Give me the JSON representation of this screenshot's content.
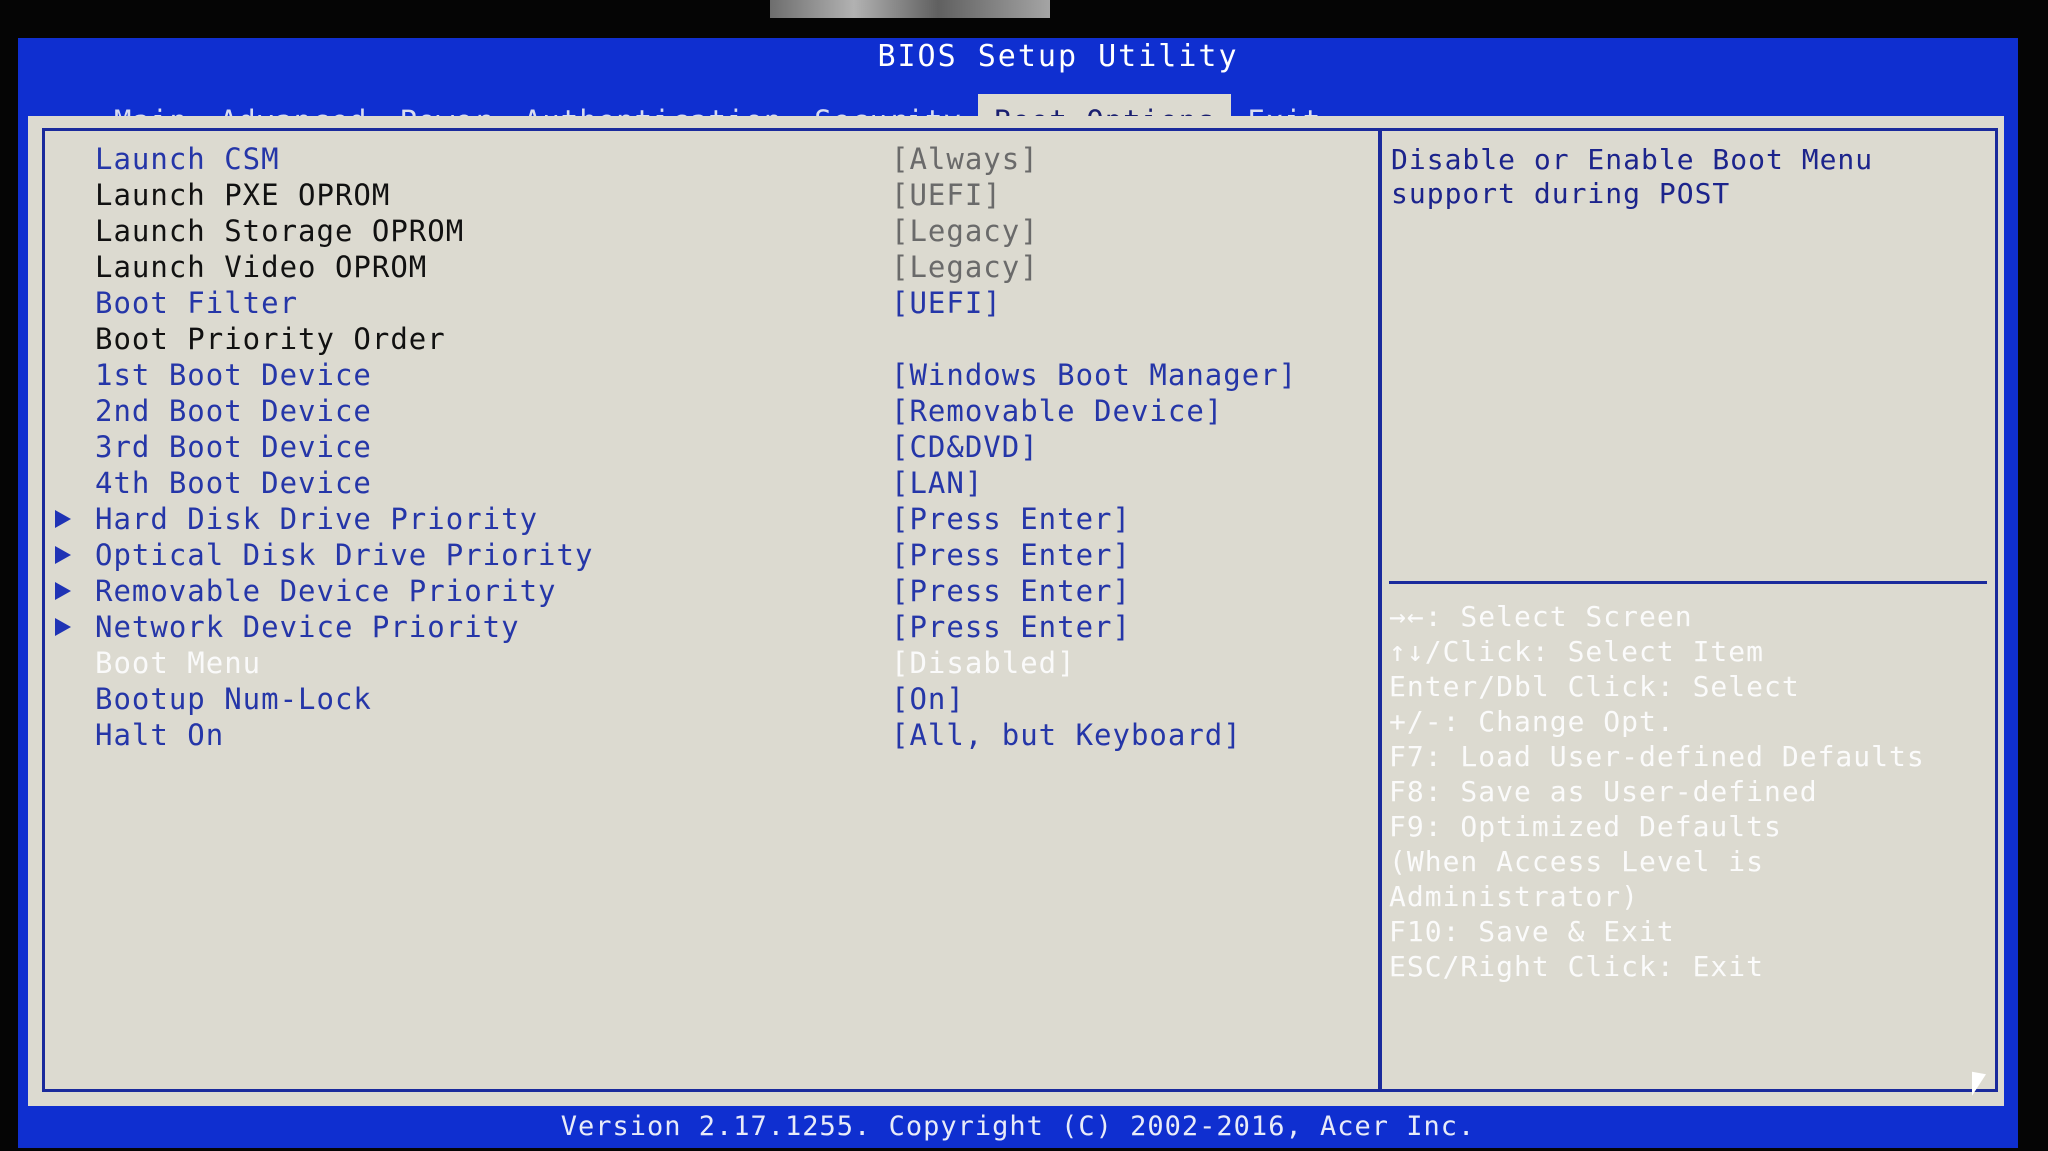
{
  "window": {
    "title": "BIOS Setup Utility"
  },
  "tabs": [
    {
      "label": "Main",
      "active": false
    },
    {
      "label": "Advanced",
      "active": false
    },
    {
      "label": "Power",
      "active": false
    },
    {
      "label": "Authentication",
      "active": false
    },
    {
      "label": "Security",
      "active": false
    },
    {
      "label": "Boot Options",
      "active": true
    },
    {
      "label": "Exit",
      "active": false
    }
  ],
  "settings": [
    {
      "label": "Launch CSM",
      "value": "[Always]",
      "submenu": false,
      "state": "enabled"
    },
    {
      "label": "Launch PXE OPROM",
      "value": "[UEFI]",
      "submenu": false,
      "state": "locked"
    },
    {
      "label": "Launch Storage OPROM",
      "value": "[Legacy]",
      "submenu": false,
      "state": "locked"
    },
    {
      "label": "Launch Video OPROM",
      "value": "[Legacy]",
      "submenu": false,
      "state": "locked"
    },
    {
      "label": "Boot Filter",
      "value": "[UEFI]",
      "submenu": false,
      "state": "enabled"
    },
    {
      "label": "Boot Priority Order",
      "value": "",
      "submenu": false,
      "state": "header"
    },
    {
      "label": "1st Boot Device",
      "value": "[Windows Boot Manager]",
      "submenu": false,
      "state": "enabled"
    },
    {
      "label": "2nd Boot Device",
      "value": "[Removable Device]",
      "submenu": false,
      "state": "enabled"
    },
    {
      "label": "3rd Boot Device",
      "value": "[CD&DVD]",
      "submenu": false,
      "state": "enabled"
    },
    {
      "label": "4th Boot Device",
      "value": "[LAN]",
      "submenu": false,
      "state": "enabled"
    },
    {
      "label": "Hard Disk Drive Priority",
      "value": "[Press Enter]",
      "submenu": true,
      "state": "enabled"
    },
    {
      "label": "Optical Disk Drive Priority",
      "value": "[Press Enter]",
      "submenu": true,
      "state": "enabled"
    },
    {
      "label": "Removable Device Priority",
      "value": "[Press Enter]",
      "submenu": true,
      "state": "enabled"
    },
    {
      "label": "Network Device Priority",
      "value": "[Press Enter]",
      "submenu": true,
      "state": "enabled"
    },
    {
      "label": "Boot Menu",
      "value": "[Disabled]",
      "submenu": false,
      "state": "selected"
    },
    {
      "label": "Bootup Num-Lock",
      "value": "[On]",
      "submenu": false,
      "state": "enabled"
    },
    {
      "label": "Halt On",
      "value": "[All, but Keyboard]",
      "submenu": false,
      "state": "enabled"
    }
  ],
  "help": {
    "description": "Disable or Enable Boot Menu\nsupport during POST"
  },
  "keys": [
    "→←: Select Screen",
    "↑↓/Click: Select Item",
    "Enter/Dbl Click: Select",
    "+/-: Change Opt.",
    "F7: Load User-defined Defaults",
    "F8: Save as User-defined",
    "F9: Optimized Defaults",
    "(When Access Level is",
    "Administrator)",
    "F10: Save & Exit",
    "ESC/Right Click: Exit"
  ],
  "footer": {
    "text": "Version 2.17.1255. Copyright (C) 2002-2016, Acer Inc."
  },
  "colors": {
    "background_blue": "#0f2fd0",
    "panel_gray": "#dcdad0",
    "text_blue": "#2536a8",
    "selected_white": "#fafafa"
  }
}
